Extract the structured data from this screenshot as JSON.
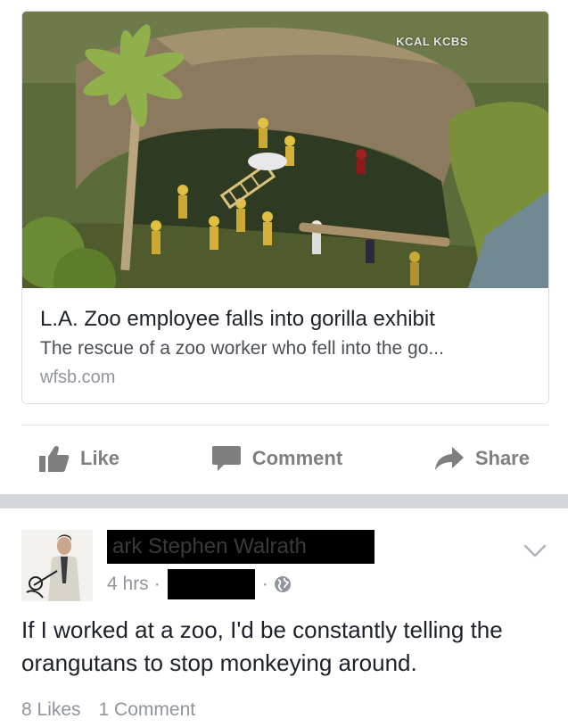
{
  "link_preview": {
    "image_watermark": "KCAL KCBS",
    "title": "L.A. Zoo employee falls into gorilla exhibit",
    "description": "The rescue of a zoo worker who fell into the go...",
    "domain": "wfsb.com"
  },
  "actions": {
    "like_label": "Like",
    "comment_label": "Comment",
    "share_label": "Share"
  },
  "post": {
    "author_name": "ark Stephen Walrath",
    "time": "4 hrs",
    "separator": "·",
    "text": "If I worked at a zoo, I'd be constantly telling the orangutans to stop monkeying around.",
    "likes": "8 Likes",
    "comments": "1 Comment"
  },
  "icons": {
    "like": "thumbs-up-icon",
    "comment": "speech-bubble-icon",
    "share": "share-arrow-icon",
    "privacy": "globe-icon",
    "menu": "chevron-down-icon"
  },
  "colors": {
    "action_gray": "#7f7f7f",
    "meta_gray": "#90949c",
    "divider": "#d3d6db",
    "text": "#1d2129"
  }
}
